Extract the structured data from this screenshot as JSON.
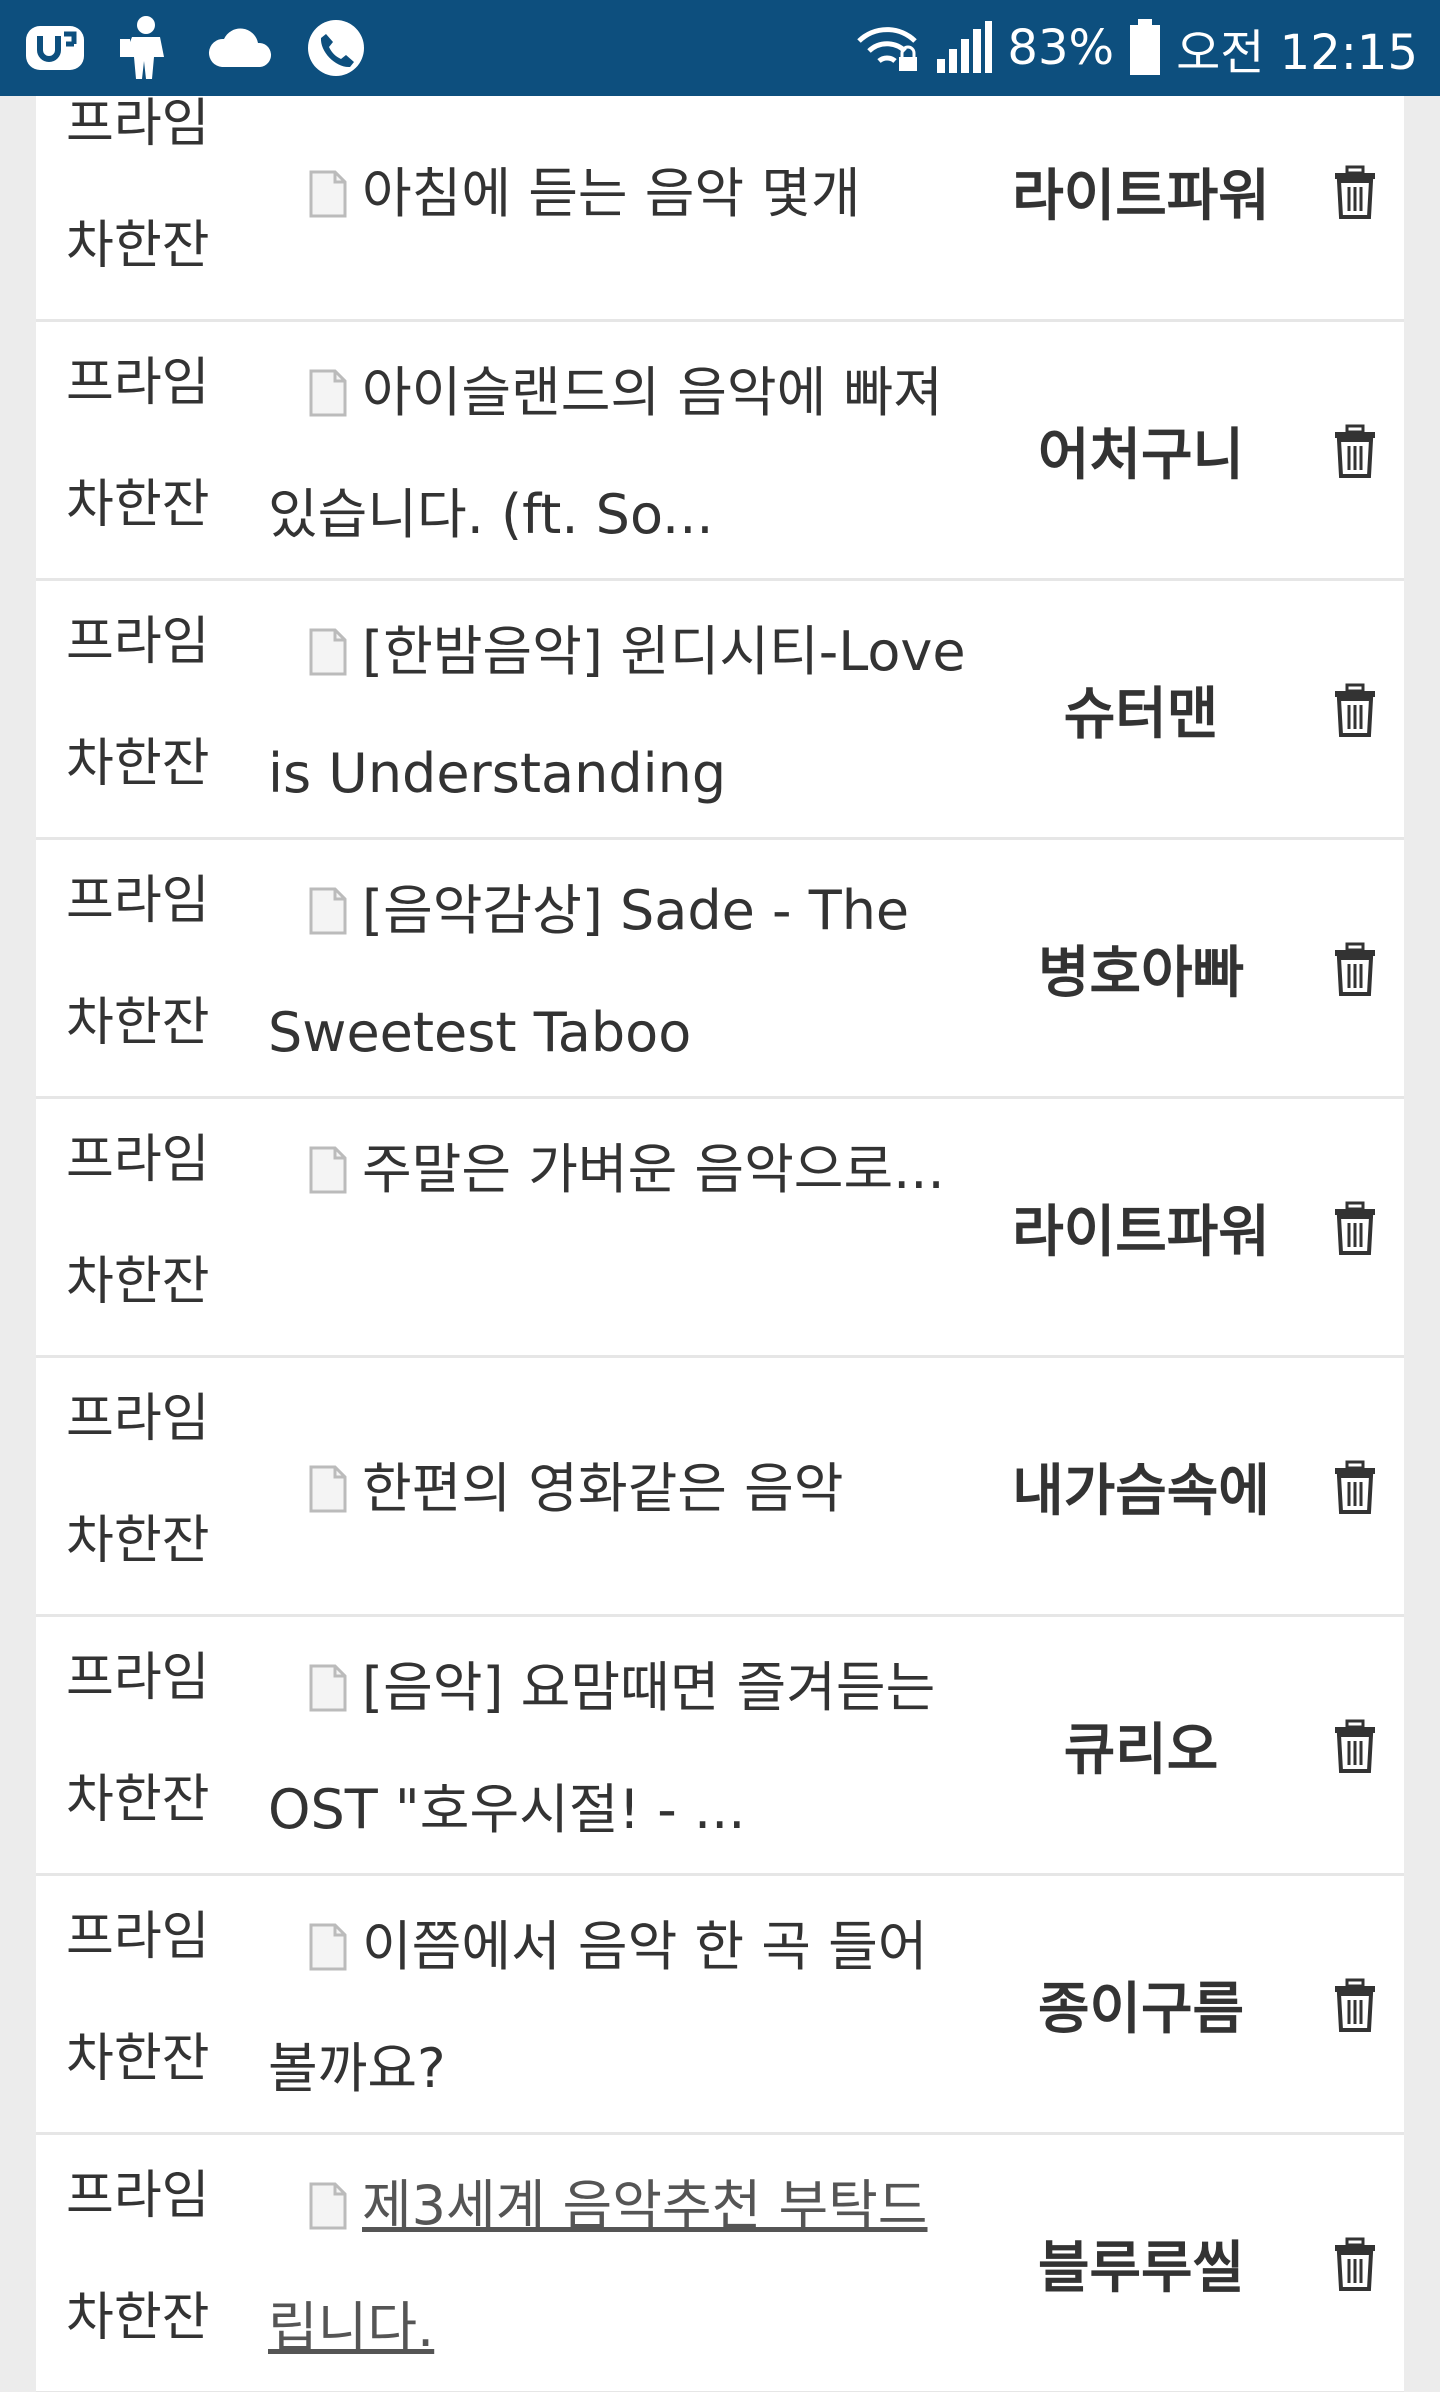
{
  "status_bar": {
    "battery_percent": "83%",
    "time": "오전 12:15",
    "left_icons": [
      "carrier-logo-icon",
      "game-character-icon",
      "cloud-icon",
      "phone-call-icon"
    ],
    "right_icons": [
      "wifi-lock-icon",
      "signal-bars-icon",
      "battery-icon"
    ],
    "background_color": "#0d4f7e"
  },
  "rows": [
    {
      "category_line1": "프라임",
      "category_line2": "차한잔",
      "title": "아침에 듣는 음악 몇개",
      "author": "라이트파워"
    },
    {
      "category_line1": "프라임",
      "category_line2": "차한잔",
      "title": "아이슬랜드의 음악에 빠져 있습니다. (ft. So...",
      "author": "어처구니"
    },
    {
      "category_line1": "프라임",
      "category_line2": "차한잔",
      "title": "[한밤음악] 윈디시티-Love is Understanding",
      "author": "슈터맨"
    },
    {
      "category_line1": "프라임",
      "category_line2": "차한잔",
      "title": "[음악감상] Sade - The Sweetest Taboo",
      "author": "병호아빠"
    },
    {
      "category_line1": "프라임",
      "category_line2": "차한잔",
      "title": "주말은 가벼운 음악으로...",
      "author": "라이트파워"
    },
    {
      "category_line1": "프라임",
      "category_line2": "차한잔",
      "title": "한편의 영화같은 음악",
      "author": "내가슴속에"
    },
    {
      "category_line1": "프라임",
      "category_line2": "차한잔",
      "title": "[음악] 요맘때면 즐겨듣는 OST \"호우시절! - ...",
      "author": "큐리오"
    },
    {
      "category_line1": "프라임",
      "category_line2": "차한잔",
      "title": "이쯤에서 음악 한 곡 들어볼까요?",
      "author": "종이구름"
    },
    {
      "category_line1": "프라임",
      "category_line2": "차한잔",
      "title": "제3세계 음악추천 부탁드립니다.",
      "author": "블루루씰"
    }
  ]
}
